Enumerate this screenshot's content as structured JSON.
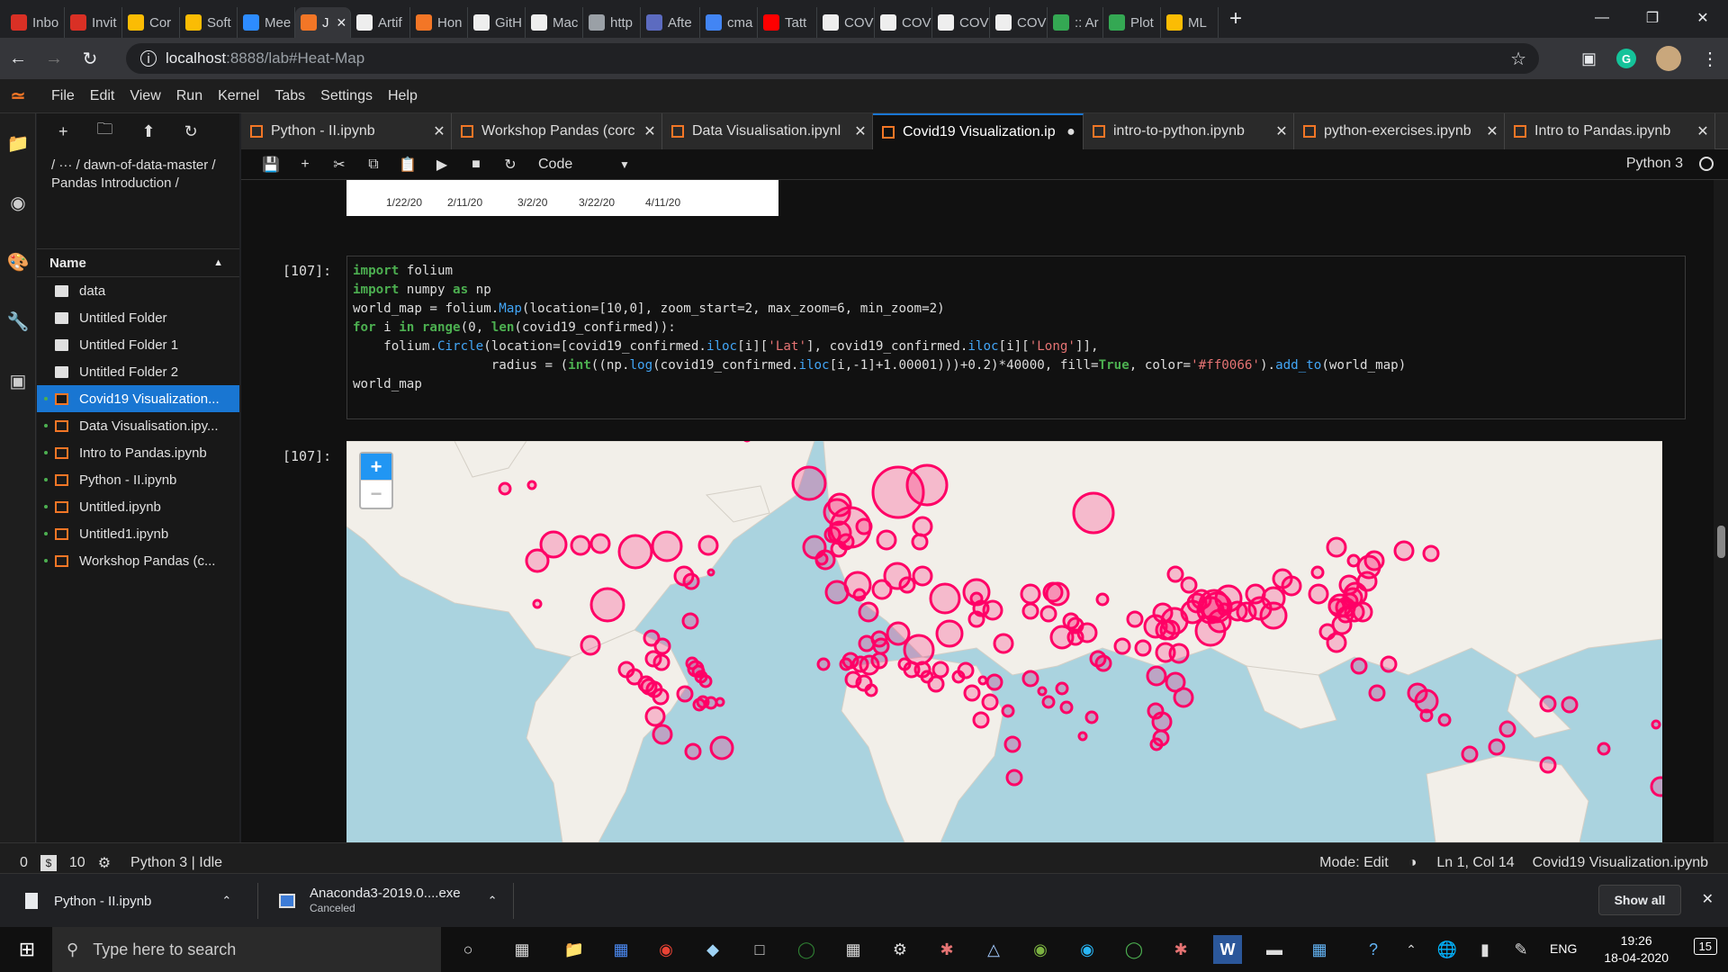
{
  "browser": {
    "tabs": [
      {
        "label": "Inbo",
        "icon": "gmail-icon",
        "color": "#d93025"
      },
      {
        "label": "Invit",
        "icon": "gmail-icon",
        "color": "#d93025"
      },
      {
        "label": "Cor",
        "icon": "drive-icon",
        "color": "#fbbc04"
      },
      {
        "label": "Soft",
        "icon": "drive-icon",
        "color": "#fbbc04"
      },
      {
        "label": "Mee",
        "icon": "zoom-icon",
        "color": "#2d8cff"
      },
      {
        "label": "J",
        "icon": "jupyter-icon",
        "color": "#f37626",
        "active": true
      },
      {
        "label": "Artif",
        "icon": "wikipedia-icon",
        "color": "#eeeeee"
      },
      {
        "label": "Hon",
        "icon": "jupyter-icon",
        "color": "#f37626"
      },
      {
        "label": "GitH",
        "icon": "github-icon",
        "color": "#eeeeee"
      },
      {
        "label": "Mac",
        "icon": "github-icon",
        "color": "#eeeeee"
      },
      {
        "label": "http",
        "icon": "globe-icon",
        "color": "#9aa0a6"
      },
      {
        "label": "Afte",
        "icon": "tableau-icon",
        "color": "#5c6bc0"
      },
      {
        "label": "cma",
        "icon": "google-icon",
        "color": "#4285f4"
      },
      {
        "label": "Tatt",
        "icon": "youtube-icon",
        "color": "#ff0000"
      },
      {
        "label": "COV",
        "icon": "github-icon",
        "color": "#eeeeee"
      },
      {
        "label": "COV",
        "icon": "github-icon",
        "color": "#eeeeee"
      },
      {
        "label": "COV",
        "icon": "github-icon",
        "color": "#eeeeee"
      },
      {
        "label": "COV",
        "icon": "github-icon",
        "color": "#eeeeee"
      },
      {
        "label": ":: Ar",
        "icon": "loader-icon",
        "color": "#34a853"
      },
      {
        "label": "Plot",
        "icon": "loader-icon",
        "color": "#34a853"
      },
      {
        "label": "ML",
        "icon": "drive-icon",
        "color": "#fbbc04"
      }
    ],
    "url_host": "localhost",
    "url_path": ":8888/lab#Heat-Map"
  },
  "menu": [
    "File",
    "Edit",
    "View",
    "Run",
    "Kernel",
    "Tabs",
    "Settings",
    "Help"
  ],
  "filebrowser": {
    "breadcrumb": "/ ··· / dawn-of-data-master / Pandas Introduction /",
    "name_header": "Name",
    "items": [
      {
        "name": "data",
        "type": "folder",
        "running": false
      },
      {
        "name": "Untitled Folder",
        "type": "folder",
        "running": false
      },
      {
        "name": "Untitled Folder 1",
        "type": "folder",
        "running": false
      },
      {
        "name": "Untitled Folder 2",
        "type": "folder",
        "running": false
      },
      {
        "name": "Covid19 Visualization...",
        "type": "notebook",
        "running": true,
        "selected": true
      },
      {
        "name": "Data Visualisation.ipy...",
        "type": "notebook",
        "running": true
      },
      {
        "name": "Intro to Pandas.ipynb",
        "type": "notebook",
        "running": true
      },
      {
        "name": "Python - II.ipynb",
        "type": "notebook",
        "running": true
      },
      {
        "name": "Untitled.ipynb",
        "type": "notebook",
        "running": true
      },
      {
        "name": "Untitled1.ipynb",
        "type": "notebook",
        "running": true
      },
      {
        "name": "Workshop Pandas (c...",
        "type": "notebook",
        "running": true
      }
    ]
  },
  "notebook_tabs": [
    {
      "label": "Python - II.ipynb"
    },
    {
      "label": "Workshop Pandas (corc"
    },
    {
      "label": "Data Visualisation.ipynl"
    },
    {
      "label": "Covid19 Visualization.ip",
      "active": true,
      "modified": true
    },
    {
      "label": "intro-to-python.ipynb"
    },
    {
      "label": "python-exercises.ipynb"
    },
    {
      "label": "Intro to Pandas.ipynb"
    }
  ],
  "toolbar": {
    "cell_type": "Code",
    "kernel": "Python 3"
  },
  "prev_chart_ticks": [
    "1/22/20",
    "2/11/20",
    "3/2/20",
    "3/22/20",
    "4/11/20"
  ],
  "cell": {
    "in_prompt": "[107]:",
    "out_prompt": "[107]:",
    "code_lines": [
      "import folium",
      "import numpy as np",
      "world_map = folium.Map(location=[10,0], zoom_start=2, max_zoom=6, min_zoom=2)",
      "for i in range(0, len(covid19_confirmed)):",
      "    folium.Circle(location=[covid19_confirmed.iloc[i]['Lat'], covid19_confirmed.iloc[i]['Long']],",
      "                  radius = (int((np.log(covid19_confirmed.iloc[i,-1]+1.00001)))+0.2)*40000, fill=True, color='#ff0066').add_to(world_map)",
      "world_map"
    ]
  },
  "map": {
    "zoom_in": "+",
    "zoom_out": "−",
    "marker_color": "#ff0066"
  },
  "statusbar": {
    "left_num": "0",
    "terminals": "10",
    "kernel_status": "Python 3 | Idle",
    "mode": "Mode: Edit",
    "position": "Ln 1, Col 14",
    "filename": "Covid19 Visualization.ipynb"
  },
  "downloads": [
    {
      "name": "Python - II.ipynb",
      "status": ""
    },
    {
      "name": "Anaconda3-2019.0....exe",
      "status": "Canceled"
    }
  ],
  "show_all": "Show all",
  "taskbar": {
    "search_placeholder": "Type here to search",
    "lang": "ENG",
    "time": "19:26",
    "date": "18-04-2020",
    "notif_count": "15"
  }
}
